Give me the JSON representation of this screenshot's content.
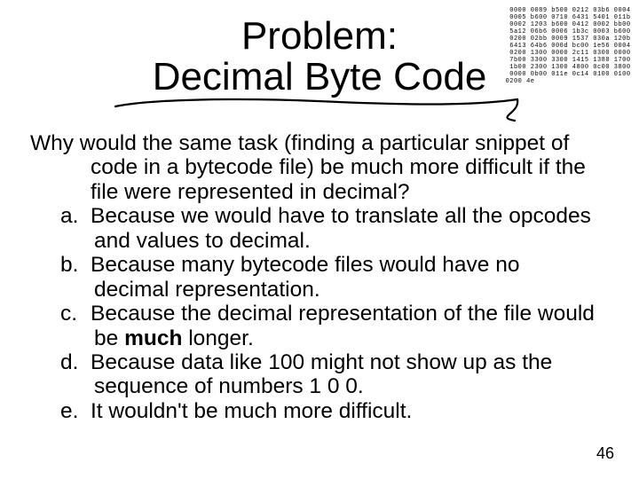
{
  "hexdump": "0000 0089 b500 0212 03b6 0004  \n0005 b600 0710 6431 5401 011b  \n0002 1203 b600 0412 0002 bb00  \n5a12 06b6 0006 1b3c 0003 b600  \n0200 02bb 0009 1537 030a 120b  \n6413 64b6 000d bc00 1e56 0004  \n0200 1300 0000 2c11 0300 0000  \n7b00 3300 3300 1415 1380 1700  \n1b00 2300 1300 4800 0c00 3800  \n0000 0b00 011e 0c14 0100 0100  \n0200 4e                         ",
  "title_line1": "Problem:",
  "title_line2": "Decimal Byte Code",
  "question": "Why would the same task (finding a particular snippet of code in a bytecode file) be much more difficult if the file were represented in decimal?",
  "options": [
    {
      "letter": "a.",
      "text": "Because we would have to translate all the opcodes and values to decimal."
    },
    {
      "letter": "b.",
      "text": "Because many bytecode files would have no decimal representation."
    },
    {
      "letter": "c.",
      "text_pre": "Because the decimal representation of the file would be ",
      "bold": "much",
      "text_post": " longer."
    },
    {
      "letter": "d.",
      "text": "Because data like 100 might not show up as the sequence of numbers 1 0 0."
    },
    {
      "letter": "e.",
      "text": "It wouldn't be much more difficult."
    }
  ],
  "page_number": "46"
}
